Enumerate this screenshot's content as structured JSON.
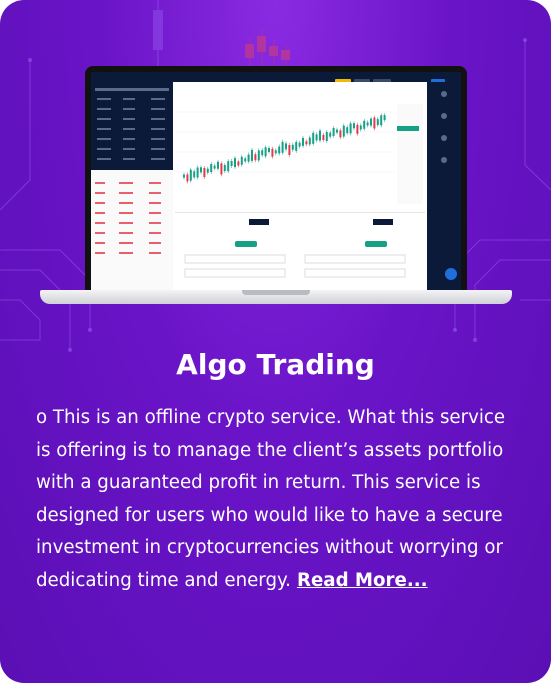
{
  "card": {
    "title": "Algo Trading",
    "description": "o This is an offline crypto service. What this service is offering is to manage the client’s assets portfolio with a guaranteed profit in return. This service is designed for users who would like to have a secure investment in cryptocurrencies without worrying or dedicating time and energy.",
    "read_more": "Read More..."
  },
  "colors": {
    "background": "#6a14c8",
    "text": "#ffffff",
    "screen_navy": "#0c1a3a",
    "candle_up": "#16a085",
    "candle_down": "#e23a4b",
    "accent_yellow": "#f5b800"
  },
  "icons": [
    "laptop-icon",
    "candlestick-chart-icon",
    "chat-bubble-icon"
  ]
}
